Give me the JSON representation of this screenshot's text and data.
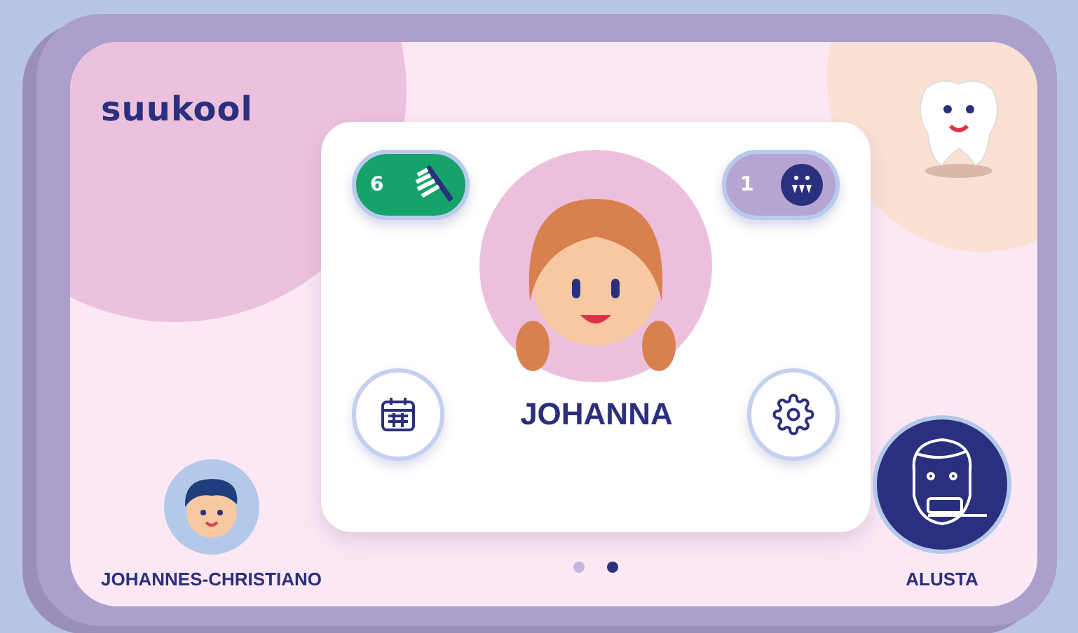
{
  "logo": {
    "text": "suukool"
  },
  "profile": {
    "name": "JOHANNA",
    "brush_count": "6",
    "smile_count": "1"
  },
  "other_profile": {
    "name": "JOHANNES-CHRISTIANO"
  },
  "start": {
    "label": "ALUSTA"
  },
  "pager": [
    {
      "selected": false
    },
    {
      "selected": true
    }
  ]
}
